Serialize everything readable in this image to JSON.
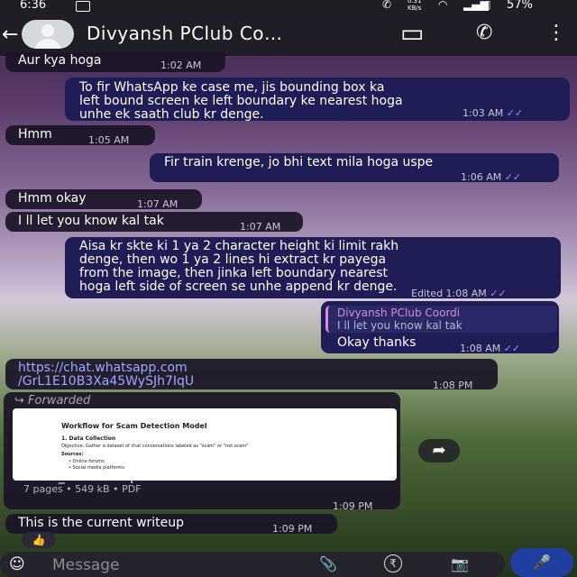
{
  "status": {
    "time": "6:36",
    "net": "0.31\nKB/s",
    "battery": "57%"
  },
  "header": {
    "title": "Divyansh PClub Co…",
    "back": "←",
    "video": "▭",
    "call": "✆",
    "menu": "⋮"
  },
  "messages": [
    {
      "dir": "in",
      "text": "Aur kya hoga",
      "time": "1:02 AM"
    },
    {
      "dir": "out",
      "text": "To fir WhatsApp ke case me, jis bounding box ka\nleft bound screen ke left boundary ke nearest hoga\nunhe ek saath club kr denge.",
      "time": "1:03 AM"
    },
    {
      "dir": "in",
      "text": "Hmm",
      "time": "1:05 AM"
    },
    {
      "dir": "out",
      "text": "Fir train krenge, jo bhi text mila hoga uspe",
      "time": "1:06 AM"
    },
    {
      "dir": "in",
      "text": "Hmm okay",
      "time": "1:07 AM"
    },
    {
      "dir": "in",
      "text": "I ll let you know kal tak",
      "time": "1:07 AM"
    },
    {
      "dir": "out",
      "text": "Aisa kr skte ki 1 ya 2 character height ki limit rakh\ndenge, then wo 1 ya 2 lines hi extract kr payega\nfrom the image, then jinka left boundary nearest\nhoga left side of screen se unhe append kr denge.",
      "time": "Edited 1:08 AM"
    },
    {
      "dir": "out",
      "quote_author": "Divyansh PClub Coordi",
      "quote_text": "I ll let you know kal tak",
      "text": "Okay thanks",
      "time": "1:08 AM"
    },
    {
      "dir": "in",
      "link": "https://chat.whatsapp.com\n/GrL1E10B3Xa45WySJh7IqU",
      "time": "1:08 PM"
    },
    {
      "dir": "in",
      "forwarded": "Forwarded",
      "doc": {
        "preview_title": "Workflow for Scam Detection Model",
        "preview_heading": "1. Data Collection",
        "preview_objective": "Objective: Gather a dataset of chat conversations labeled as \"scam\" or \"not scam\"",
        "preview_sources": "Sources:",
        "preview_items": [
          "Online forums",
          "Social media platforms"
        ],
        "name": "Scam_Detection.pdf",
        "meta": "7 pages • 549 kB • PDF"
      },
      "time": "1:09 PM"
    },
    {
      "dir": "in",
      "text": "This is the current writeup",
      "time": "1:09 PM",
      "reaction": "👍"
    }
  ],
  "composer": {
    "placeholder": "Message",
    "emoji": "☺",
    "attach": "📎",
    "payment": "₹",
    "camera": "📷",
    "mic": "🎤",
    "share": "➦"
  },
  "colors": {
    "outgoing": "#1e1d55",
    "incoming": "#1a1426",
    "ticks": "#9b8cff",
    "link": "#9da9ff",
    "quote": "#d98bd8"
  }
}
